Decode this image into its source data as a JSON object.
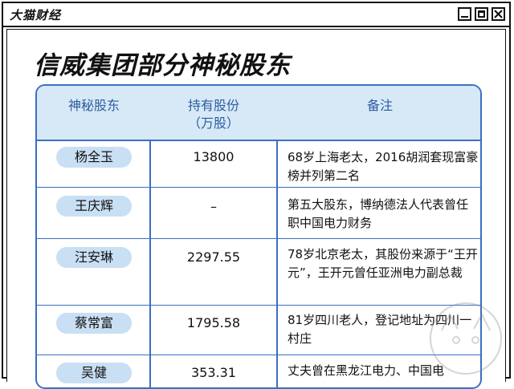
{
  "window": {
    "brand": "大猫财经",
    "title": "信威集团部分神秘股东"
  },
  "table": {
    "headers": [
      "神秘股东",
      "持有股份\n（万股）",
      "备注"
    ],
    "header_shareholder": "神秘股东",
    "header_shares_line1": "持有股份",
    "header_shares_line2": "（万股）",
    "header_note": "备注",
    "rows": [
      {
        "name": "杨全玉",
        "shares": "13800",
        "note": "68岁上海老太，2016胡润套现富豪榜并列第二名"
      },
      {
        "name": "王庆辉",
        "shares": "–",
        "note": "第五大股东，博纳德法人代表曾任职中国电力财务"
      },
      {
        "name": "汪安琳",
        "shares": "2297.55",
        "note": "78岁北京老太，其股份来源于“王开元”，王开元曾任亚洲电力副总裁"
      },
      {
        "name": "蔡常富",
        "shares": "1795.58",
        "note": "81岁四川老人，登记地址为四川一村庄"
      },
      {
        "name": "吴健",
        "shares": "353.31",
        "note": "丈夫曾在黑龙江电力、中国电"
      }
    ]
  },
  "colors": {
    "header_bg": "#d7e9f7",
    "border": "#3a6fc0",
    "pill_bg": "#c9dff3",
    "header_text": "#2c5d9e"
  },
  "icons": {
    "minimize": "minimize-icon",
    "maximize": "maximize-icon",
    "close": "close-icon",
    "stamp": "watermark-stamp-icon"
  }
}
